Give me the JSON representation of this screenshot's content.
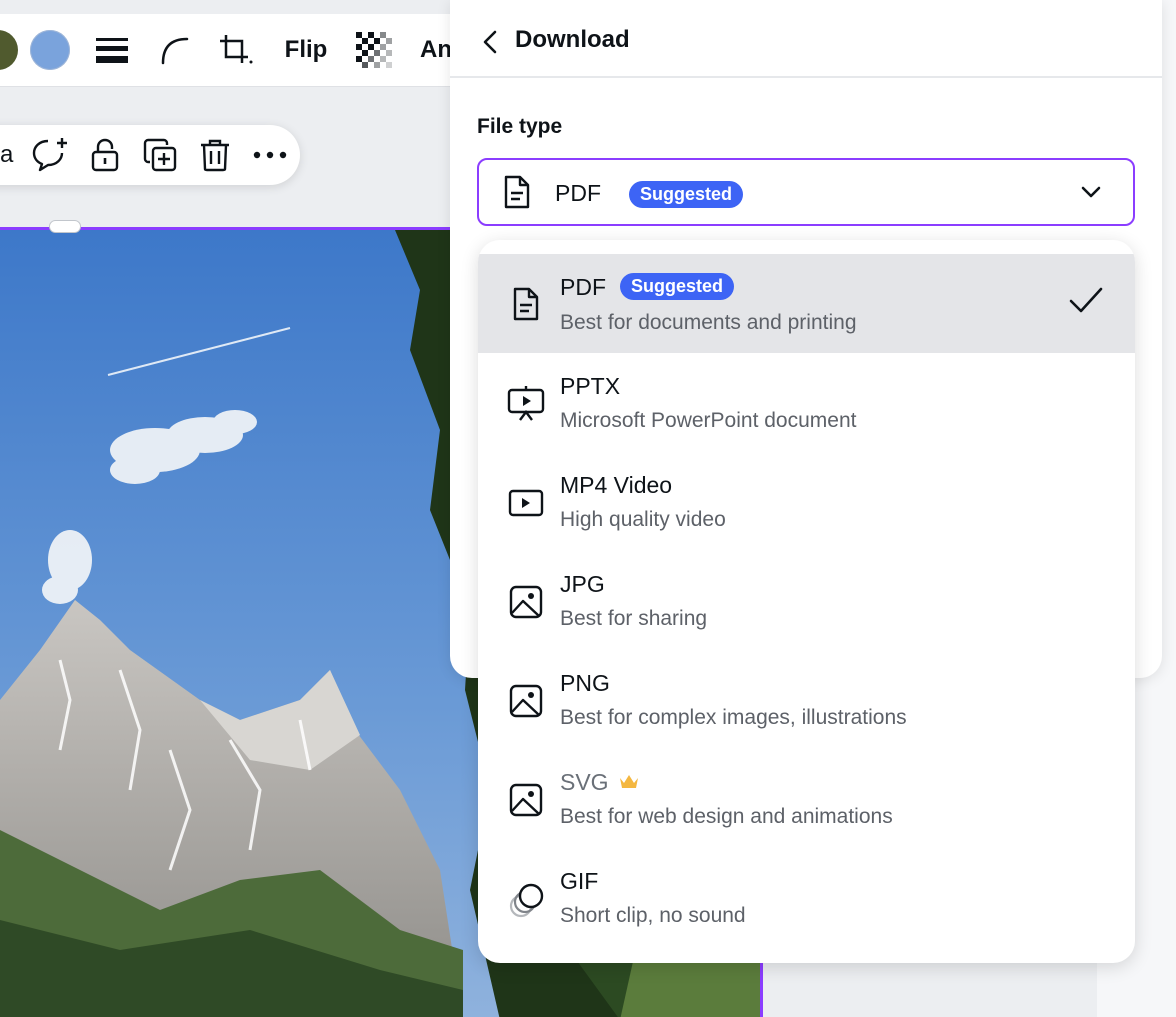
{
  "toolbar": {
    "swatch_colors": [
      "#505a2e",
      "#7aa3dc"
    ],
    "flip_label": "Flip",
    "animate_label_partial": "An",
    "icons": [
      "border-style-icon",
      "corner-rounding-icon",
      "crop-icon",
      "transparency-icon"
    ]
  },
  "float_toolbar": {
    "partial_label": "a",
    "icons": [
      "comment-add-icon",
      "lock-icon",
      "duplicate-icon",
      "trash-icon",
      "more-icon"
    ]
  },
  "panel": {
    "title": "Download",
    "file_type_label": "File type",
    "selected_value": "PDF",
    "selected_badge": "Suggested"
  },
  "accent_color": "#8b3dff",
  "badge_color": "#3d64f5",
  "options": [
    {
      "title": "PDF",
      "badge": "Suggested",
      "desc": "Best for documents and printing",
      "icon": "document-icon",
      "selected": true
    },
    {
      "title": "PPTX",
      "desc": "Microsoft PowerPoint document",
      "icon": "presentation-icon"
    },
    {
      "title": "MP4 Video",
      "desc": "High quality video",
      "icon": "video-icon"
    },
    {
      "title": "JPG",
      "desc": "Best for sharing",
      "icon": "image-icon"
    },
    {
      "title": "PNG",
      "desc": "Best for complex images, illustrations",
      "icon": "image-icon"
    },
    {
      "title": "SVG",
      "desc": "Best for web design and animations",
      "icon": "image-icon",
      "premium": true
    },
    {
      "title": "GIF",
      "desc": "Short clip, no sound",
      "icon": "gif-icon"
    }
  ]
}
